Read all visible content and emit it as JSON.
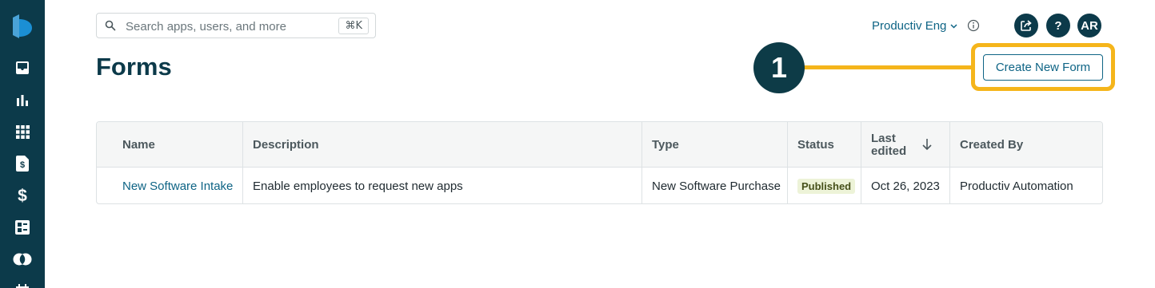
{
  "sidebar": {
    "icons": [
      "inbox-icon",
      "bar-chart-icon",
      "apps-grid-icon",
      "document-dollar-icon",
      "dollar-icon",
      "forms-icon",
      "overlap-circles-icon",
      "calendar-icon"
    ]
  },
  "header": {
    "search_placeholder": "Search apps, users, and more",
    "search_shortcut": "⌘K",
    "org_name": "Productiv Eng",
    "avatar_initials": "AR",
    "help_label": "?"
  },
  "page": {
    "title": "Forms",
    "create_button": "Create New Form",
    "annotation_step": "1"
  },
  "table": {
    "columns": {
      "name": "Name",
      "description": "Description",
      "type": "Type",
      "status": "Status",
      "last_edited_line1": "Last",
      "last_edited_line2": "edited",
      "created_by": "Created By"
    },
    "rows": [
      {
        "name": "New Software Intake",
        "description": "Enable employees to request new apps",
        "type": "New Software Purchase",
        "status": "Published",
        "last_edited": "Oct 26, 2023",
        "created_by": "Productiv Automation"
      }
    ]
  },
  "colors": {
    "sidebar_bg": "#0c3a4a",
    "accent": "#0e6485",
    "highlight": "#f5b51b",
    "status_badge_bg": "#edf3d8"
  }
}
